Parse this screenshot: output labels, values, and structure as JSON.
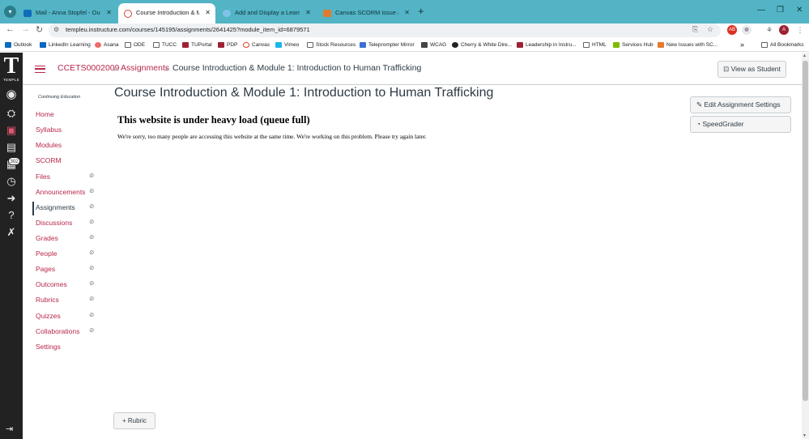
{
  "browser": {
    "tabs": [
      {
        "label": "Mail - Anna Stopfel - Outlook",
        "favicon_color": "#0f6cbd"
      },
      {
        "label": "Course Introduction & Module",
        "favicon_color": "#d0463b"
      },
      {
        "label": "Add and Display a Learner's Na",
        "favicon_color": "#7fc4e8"
      },
      {
        "label": "Canvas SCORM issue after the",
        "favicon_color": "#e27b2f"
      }
    ],
    "url": "templeu.instructure.com/courses/145195/assignments/2641425?module_item_id=6879571",
    "bookmarks": [
      {
        "label": "Outlook",
        "color": "#0f6cbd"
      },
      {
        "label": "LinkedIn Learning",
        "color": "#0a66c2"
      },
      {
        "label": "Asana",
        "color": "#f06a6a"
      },
      {
        "label": "ODE",
        "folder": true
      },
      {
        "label": "TUCC",
        "folder": true
      },
      {
        "label": "TUPortal",
        "color": "#9d2235"
      },
      {
        "label": "PDP",
        "color": "#9d2235"
      },
      {
        "label": "Canvas",
        "color": "#e13f2b"
      },
      {
        "label": "Vimeo",
        "color": "#1ab7ea"
      },
      {
        "label": "Stock Resources",
        "folder": true
      },
      {
        "label": "Teleprompter Mirror",
        "color": "#3b6fd4"
      },
      {
        "label": "WCAG",
        "color": "#444444"
      },
      {
        "label": "Cherry & White Dire...",
        "color": "#222222"
      },
      {
        "label": "Leadership in Instru...",
        "color": "#9d2235"
      },
      {
        "label": "HTML",
        "folder": true
      },
      {
        "label": "Services Hub",
        "color": "#7fba00"
      },
      {
        "label": "New Issues with SC...",
        "color": "#e27b2f"
      }
    ],
    "more_bookmarks": "»",
    "all_bookmarks": "All Bookmarks"
  },
  "global_nav": {
    "logo_letter": "T",
    "logo_word": "TEMPLE",
    "inbox_badge": "302"
  },
  "breadcrumb": {
    "course": "CCETS0002009",
    "section": "Assignments",
    "current": "Course Introduction & Module 1: Introduction to Human Trafficking",
    "separator": "›"
  },
  "header": {
    "view_as_student": "View as Student"
  },
  "course_nav": {
    "subtitle": "Continuing Education",
    "items": [
      {
        "label": "Home",
        "hidden": false
      },
      {
        "label": "Syllabus",
        "hidden": false
      },
      {
        "label": "Modules",
        "hidden": false
      },
      {
        "label": "SCORM",
        "hidden": false
      },
      {
        "label": "Files",
        "hidden": true
      },
      {
        "label": "Announcements",
        "hidden": true
      },
      {
        "label": "Assignments",
        "hidden": true,
        "active": true
      },
      {
        "label": "Discussions",
        "hidden": true
      },
      {
        "label": "Grades",
        "hidden": true
      },
      {
        "label": "People",
        "hidden": true
      },
      {
        "label": "Pages",
        "hidden": true
      },
      {
        "label": "Outcomes",
        "hidden": true
      },
      {
        "label": "Rubrics",
        "hidden": true
      },
      {
        "label": "Quizzes",
        "hidden": true
      },
      {
        "label": "Collaborations",
        "hidden": true
      },
      {
        "label": "Settings",
        "hidden": false
      }
    ]
  },
  "main": {
    "title": "Course Introduction & Module 1: Introduction to Human Trafficking",
    "error_title": "This website is under heavy load (queue full)",
    "error_message": "We're sorry, too many people are accessing this website at the same time. We're working on this problem. Please try again later.",
    "rubric_button": "+ Rubric"
  },
  "aside": {
    "edit_button": "Edit Assignment Settings",
    "speedgrader_button": "SpeedGrader"
  }
}
